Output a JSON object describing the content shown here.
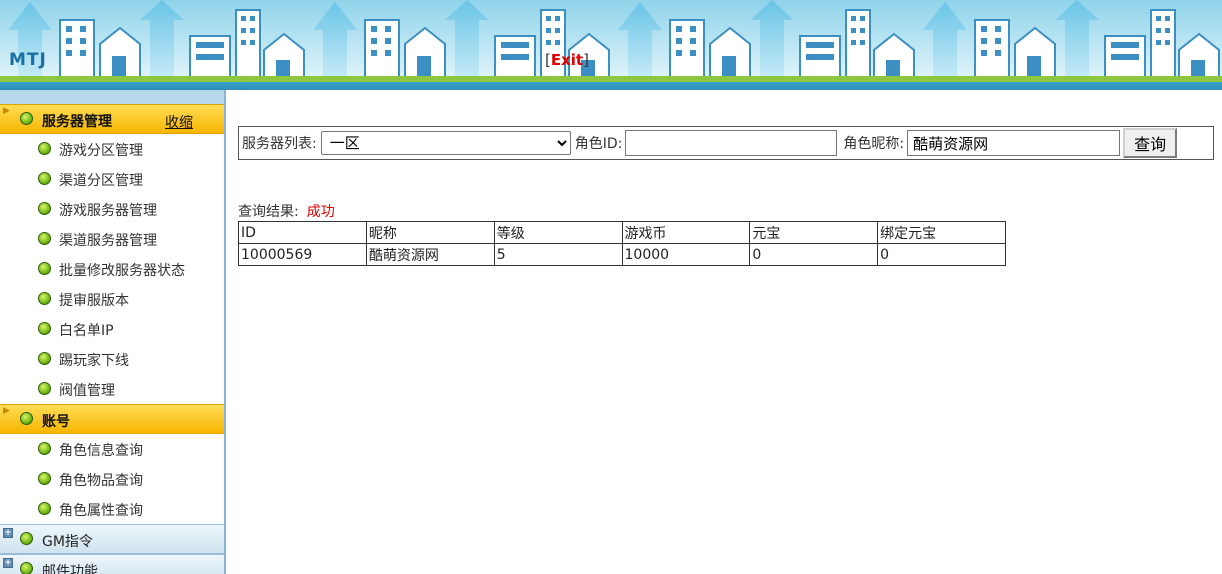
{
  "header": {
    "logo": "MTJ",
    "exit_open": "[",
    "exit_label": "Exit",
    "exit_close": "]"
  },
  "sidebar": {
    "sections": [
      {
        "title": "服务器管理",
        "collapse_label": "收缩",
        "items": [
          "游戏分区管理",
          "渠道分区管理",
          "游戏服务器管理",
          "渠道服务器管理",
          "批量修改服务器状态",
          "提审服版本",
          "白名单IP",
          "踢玩家下线",
          "阀值管理"
        ]
      },
      {
        "title": "账号",
        "items": [
          "角色信息查询",
          "角色物品查询",
          "角色属性查询"
        ]
      },
      {
        "title": "GM指令"
      },
      {
        "title": "邮件功能"
      }
    ]
  },
  "search": {
    "server_list_label": "服务器列表:",
    "server_selected": "一区",
    "role_id_label": "角色ID:",
    "role_id_value": "",
    "nickname_label": "角色昵称:",
    "nickname_value": "酷萌资源网",
    "query_button": "查询"
  },
  "result": {
    "label": "查询结果:",
    "status": "成功",
    "columns": [
      "ID",
      "昵称",
      "等级",
      "游戏币",
      "元宝",
      "绑定元宝"
    ],
    "rows": [
      [
        "10000569",
        "酷萌资源网",
        "5",
        "10000",
        "0",
        "0"
      ]
    ]
  },
  "colors": {
    "accent": "#f7b500",
    "status_ok": "#e00000",
    "header_sky": "#b8e4ef"
  }
}
